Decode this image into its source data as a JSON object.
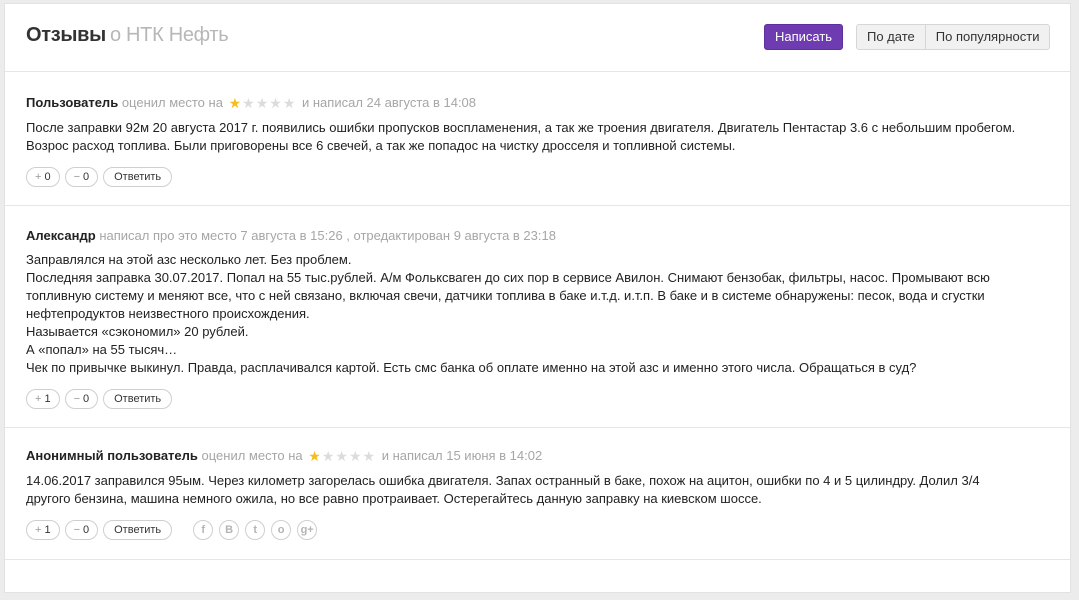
{
  "header": {
    "title": "Отзывы",
    "subtitle": "о НТК Нефть",
    "write_label": "Написать",
    "sort_by_date": "По дате",
    "sort_by_popularity": "По популярности"
  },
  "reviews": [
    {
      "author": "Пользователь",
      "rated_text": "оценил место на",
      "rating": 1,
      "rating_max": 5,
      "after_text": "и написал 24 августа в 14:08",
      "paragraphs": [
        "После заправки 92м 20 августа 2017 г. появились ошибки пропусков воспламенения, а так же троения двигателя. Двигатель Пентастар 3.6 с небольшим пробегом. Возрос расход топлива. Были приговорены все 6 свечей, а так же попадос на чистку дросселя и топливной системы."
      ],
      "plus_count": "0",
      "minus_count": "0",
      "answer_label": "Ответить"
    },
    {
      "author": "Александр",
      "meta_text": "написал про это место 7 августа в 15:26 , отредактирован 9 августа в 23:18",
      "paragraphs": [
        "Заправлялся на этой азс несколько лет. Без проблем.",
        "Последняя заправка 30.07.2017. Попал на 55 тыс.рублей. А/м Фольксваген до сих пор в сервисе Авилон. Снимают бензобак, фильтры, насос. Промывают всю топливную систему и меняют все, что с ней связано, включая свечи, датчики топлива в баке и.т.д. и.т.п. В баке и в системе обнаружены: песок, вода и сгустки нефтепродуктов неизвестного происхождения.",
        "Называется «сэкономил» 20 рублей.",
        "А «попал» на 55 тысяч…",
        "Чек по привычке выкинул. Правда, расплачивался картой. Есть смс банка об оплате именно на этой азс и именно этого числа. Обращаться в суд?"
      ],
      "plus_count": "1",
      "minus_count": "0",
      "answer_label": "Ответить"
    },
    {
      "author": "Анонимный пользователь",
      "rated_text": "оценил место на",
      "rating": 1,
      "rating_max": 5,
      "after_text": "и написал 15 июня в 14:02",
      "paragraphs": [
        "14.06.2017 заправился 95ым. Через километр загорелась ошибка двигателя. Запах остранный в баке, похож на ацитон, ошибки по 4 и 5 цилиндру. Долил 3/4 другого бензина, машина немного ожила, но все равно протраивает. Остерегайтесь данную заправку на киевском шоссе."
      ],
      "plus_count": "1",
      "minus_count": "0",
      "answer_label": "Ответить",
      "share_icons": [
        "facebook-icon",
        "vk-icon",
        "twitter-icon",
        "odnoklassniki-icon",
        "google-plus-icon"
      ]
    }
  ],
  "colors": {
    "accent": "#6e3bb1",
    "star_on": "#f5bd1f",
    "star_off": "#dcdcdc",
    "muted_text": "#a6a6a6"
  }
}
